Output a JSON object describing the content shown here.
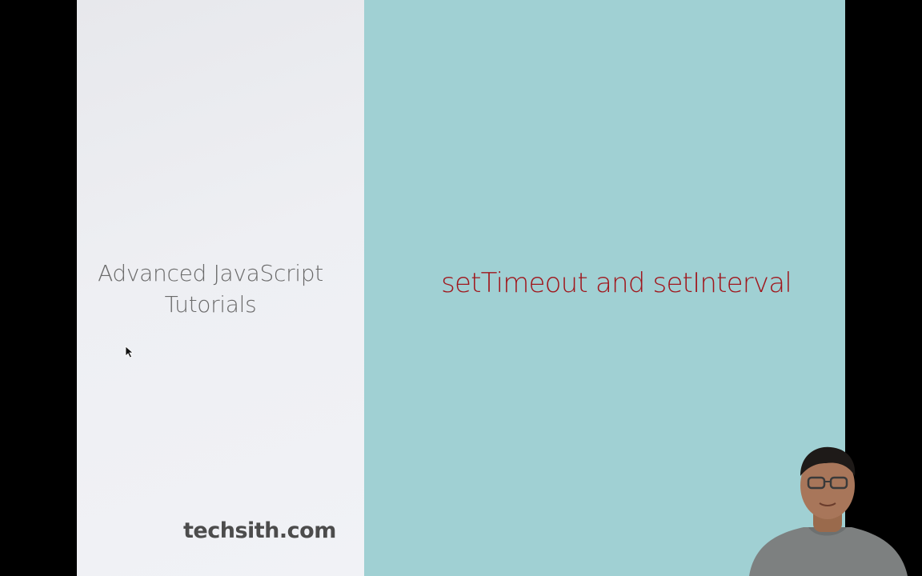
{
  "slide": {
    "series_title_line1": "Advanced JavaScript",
    "series_title_line2": "Tutorials",
    "lesson_title": "setTimeout and setInterval",
    "brand": "techsith.com"
  },
  "colors": {
    "left_panel": "#eeeff3",
    "right_panel": "#a0d0d3",
    "lesson_title": "#a0161c",
    "series_title": "#6a6a6a",
    "brand": "#4c4c4c",
    "letterbox": "#000000"
  },
  "icons": {
    "cursor": "mouse-pointer-icon"
  }
}
